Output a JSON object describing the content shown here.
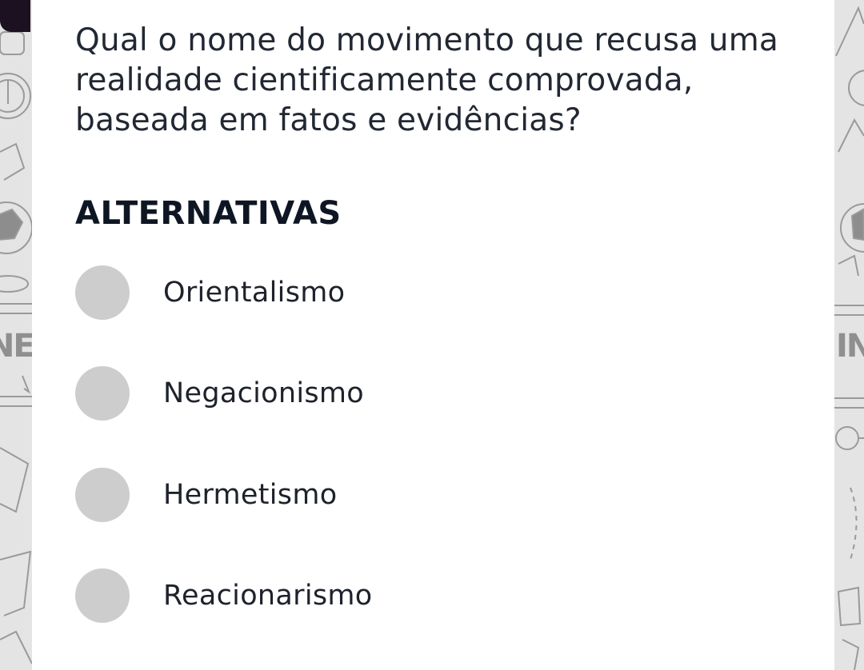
{
  "question": {
    "text": "Qual o nome do movimento que recusa uma realidade cientificamente comprovada, baseada em fatos e evidências?"
  },
  "alternatives": {
    "title": "ALTERNATIVAS",
    "options": [
      {
        "label": "Orientalismo"
      },
      {
        "label": "Negacionismo"
      },
      {
        "label": "Hermetismo"
      },
      {
        "label": "Reacionarismo"
      }
    ]
  },
  "background": {
    "doodle_text": "INE"
  },
  "colors": {
    "radio": "#cdcdcd",
    "question_text": "#222833",
    "title_text": "#0f1623",
    "card_bg": "#ffffff",
    "page_bg": "#e6e6e6"
  }
}
